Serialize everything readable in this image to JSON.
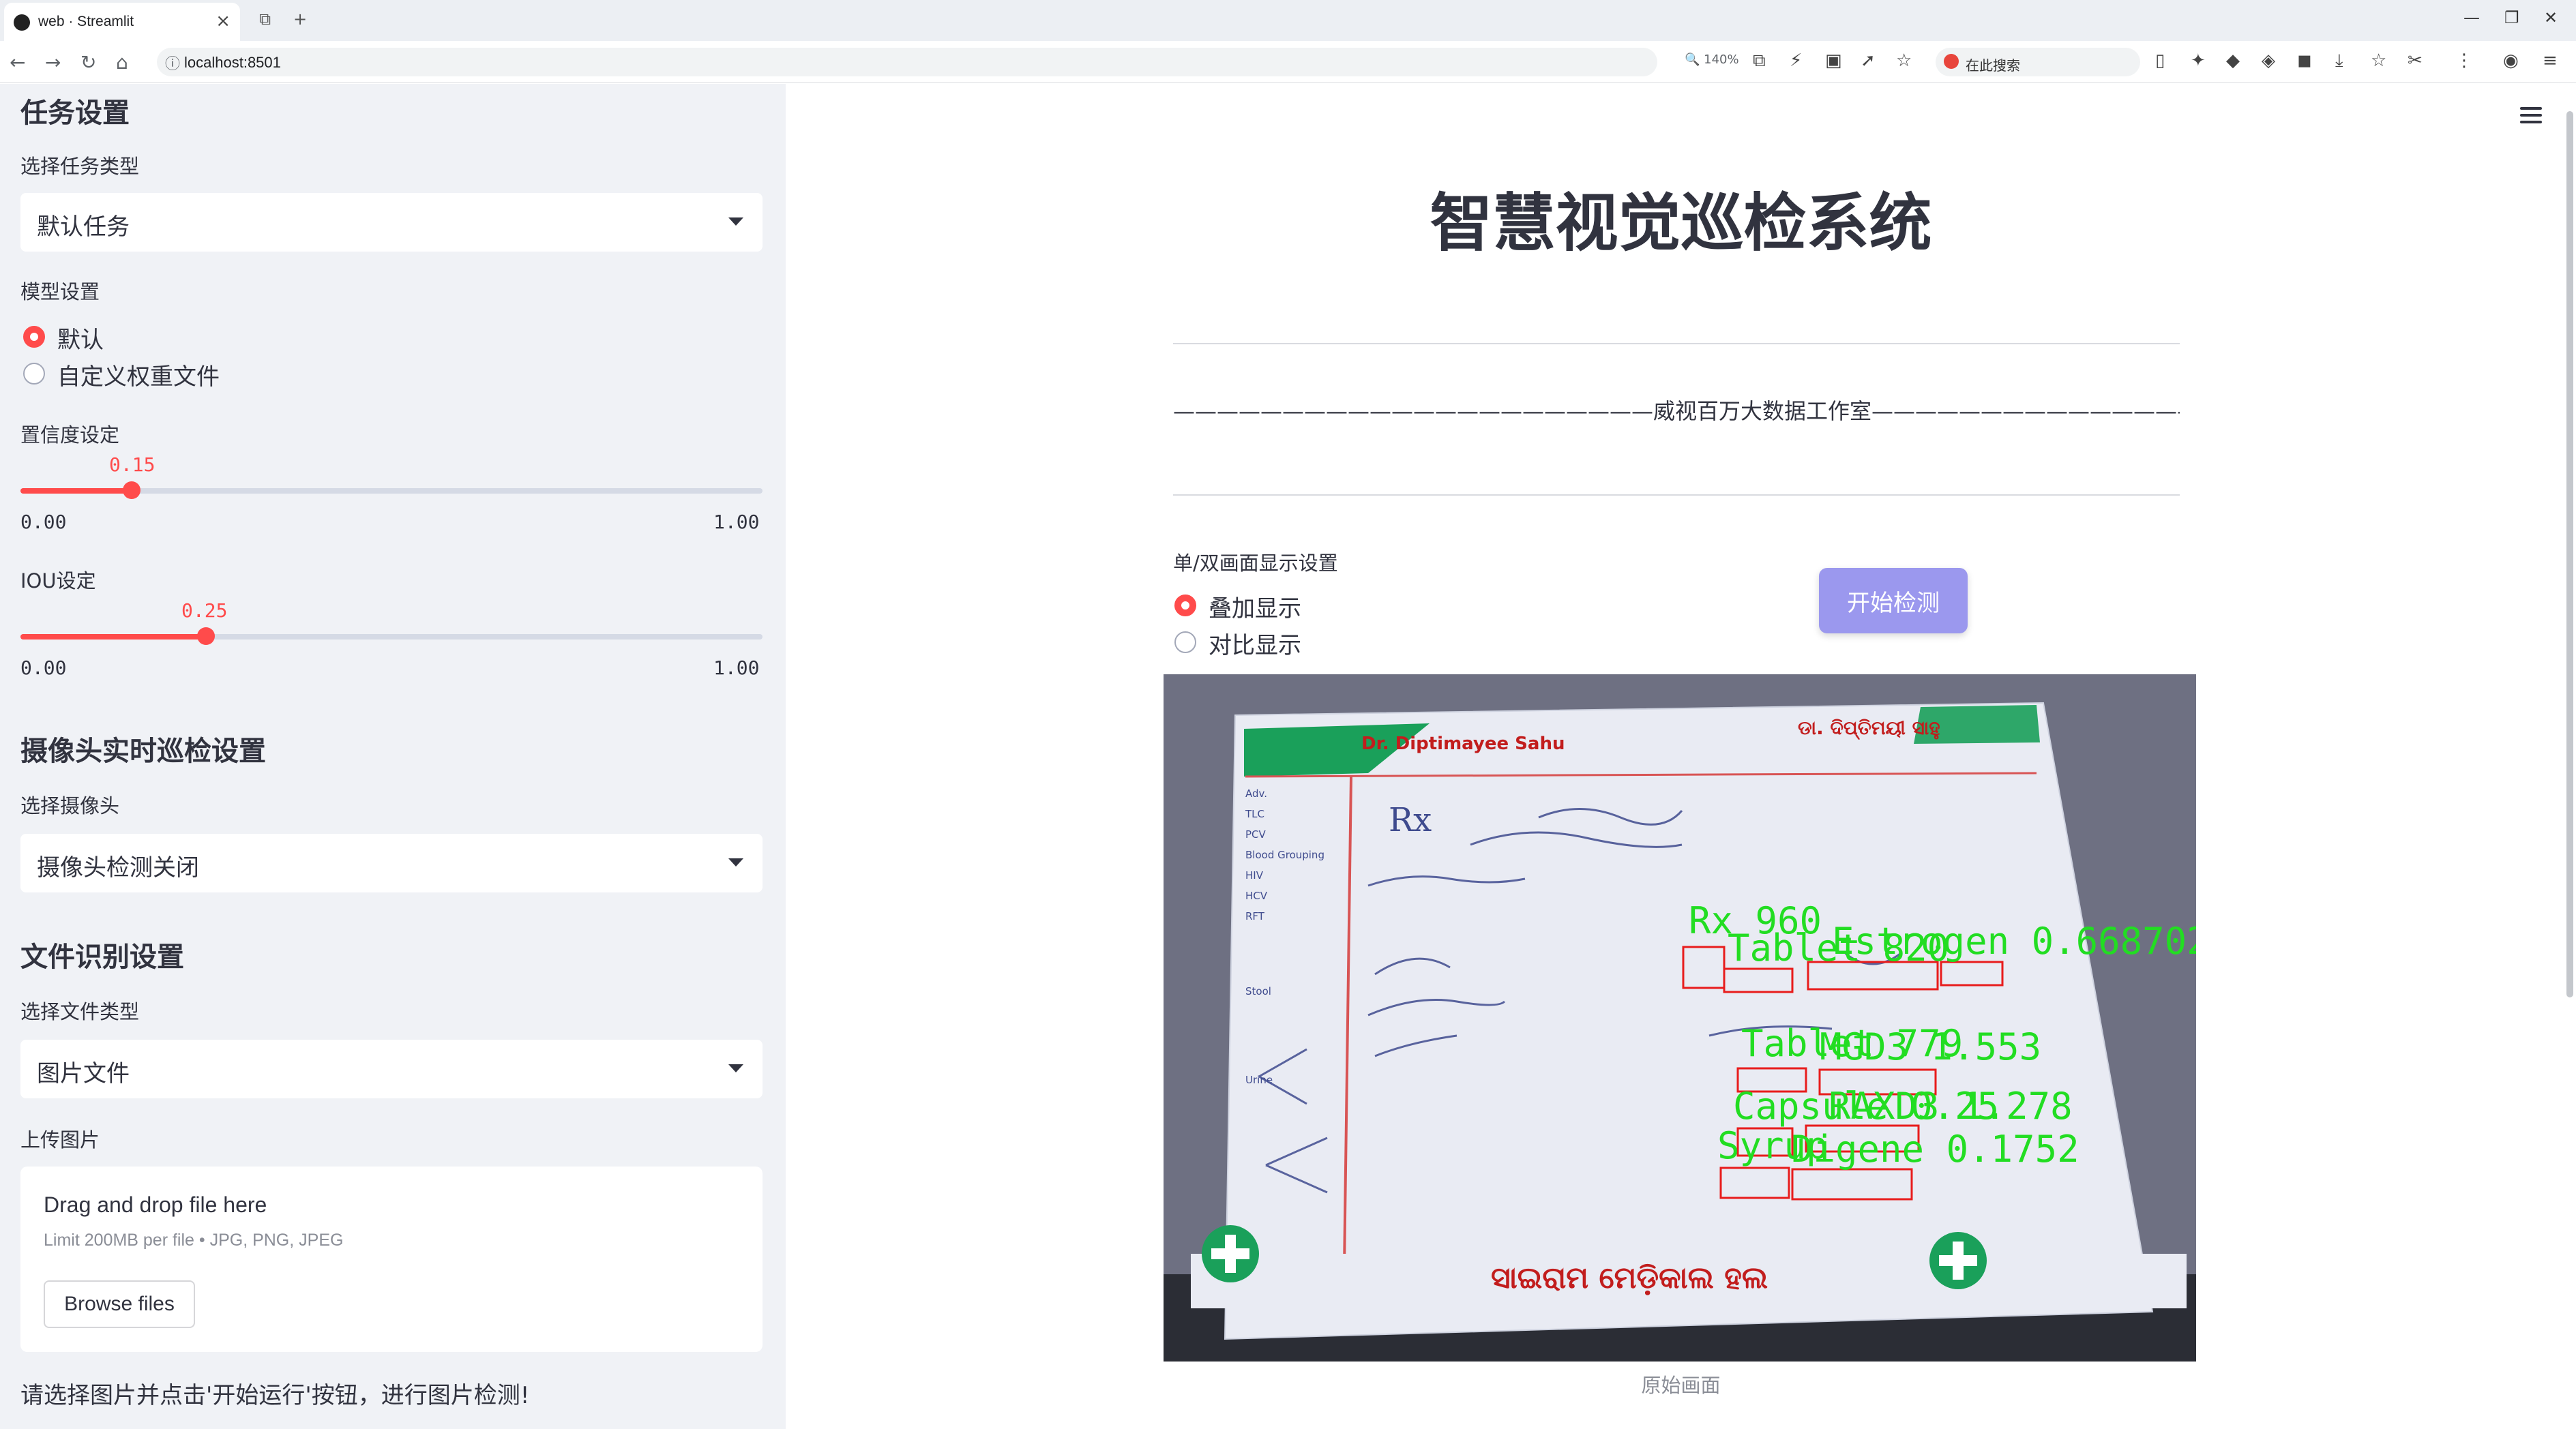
{
  "browser": {
    "tab_title": "web · Streamlit",
    "url": "localhost:8501",
    "zoom": "140%",
    "search_placeholder": "在此搜索"
  },
  "sidebar": {
    "task_heading": "任务设置",
    "task_type_label": "选择任务类型",
    "task_type_value": "默认任务",
    "model_label": "模型设置",
    "model_options": [
      "默认",
      "自定义权重文件"
    ],
    "model_selected": "默认",
    "conf_label": "置信度设定",
    "conf_value": "0.15",
    "conf_min": "0.00",
    "conf_max": "1.00",
    "iou_label": "IOU设定",
    "iou_value": "0.25",
    "iou_min": "0.00",
    "iou_max": "1.00",
    "camera_heading": "摄像头实时巡检设置",
    "camera_label": "选择摄像头",
    "camera_value": "摄像头检测关闭",
    "file_heading": "文件识别设置",
    "file_type_label": "选择文件类型",
    "file_type_value": "图片文件",
    "upload_label": "上传图片",
    "uploader_title": "Drag and drop file here",
    "uploader_limit": "Limit 200MB per file • JPG, PNG, JPEG",
    "browse_label": "Browse files",
    "note": "请选择图片并点击'开始运行'按钮，进行图片检测!"
  },
  "main": {
    "title": "智慧视觉巡检系统",
    "studio_line": "——————————————————————威视百万大数据工作室——————————————————————",
    "display_label": "单/双画面显示设置",
    "display_options": [
      "叠加显示",
      "对比显示"
    ],
    "display_selected": "叠加显示",
    "start_button": "开始检测",
    "caption": "原始画面"
  },
  "prescription": {
    "doctor": "Dr. Diptimayee Sahu",
    "odia_header": "ଡା. ଦିପ୍ତିମୟୀ ସାହୁ",
    "rx": "Rx",
    "footer_odia": "ସାଇରାମ ମେଡ଼ିକାଲ ହଲ",
    "detections": [
      {
        "label": "Rx 960",
        "kind": "rx"
      },
      {
        "label": "Tablet 820",
        "kind": "tab"
      },
      {
        "label": "Estrogen 0.668702",
        "kind": "med"
      },
      {
        "label": "Tablet 779",
        "kind": "tab"
      },
      {
        "label": "MGD3 1.553",
        "kind": "med"
      },
      {
        "label": "Capsule 0.25",
        "kind": "cap"
      },
      {
        "label": "RAXD3 1.278",
        "kind": "med"
      },
      {
        "label": "Syrup",
        "kind": "syr"
      },
      {
        "label": "Digene 0.1752",
        "kind": "med"
      }
    ]
  },
  "colors": {
    "accent": "#ff4b4b",
    "button": "#9b98ee",
    "sidebar_bg": "#f0f2f6",
    "detection_text": "#22dd22",
    "detection_box": "#e81c1c"
  }
}
